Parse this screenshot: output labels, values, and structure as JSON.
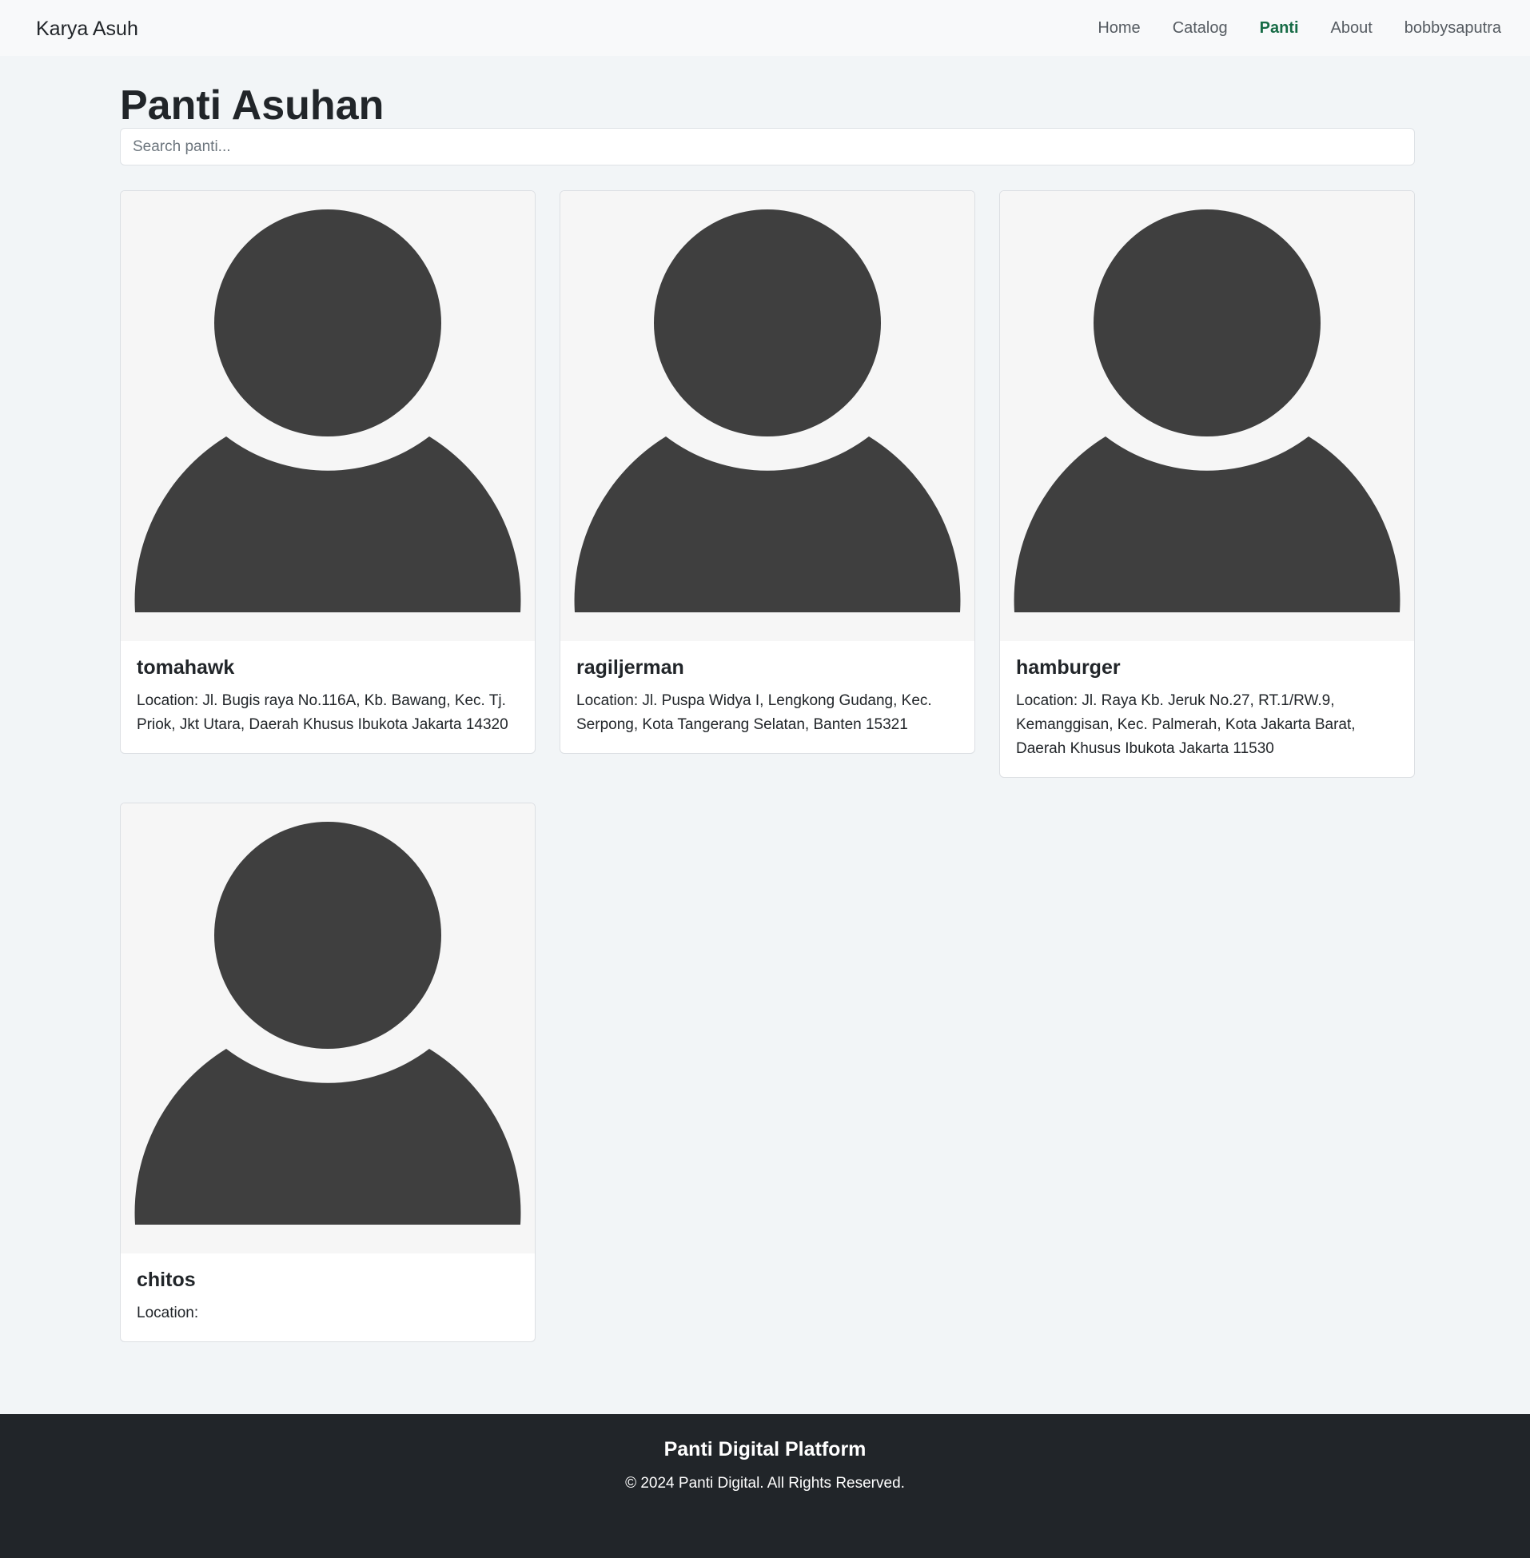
{
  "navbar": {
    "brand": "Karya Asuh",
    "links": [
      {
        "label": "Home",
        "active": false
      },
      {
        "label": "Catalog",
        "active": false
      },
      {
        "label": "Panti",
        "active": true
      },
      {
        "label": "About",
        "active": false
      },
      {
        "label": "bobbysaputra",
        "active": false
      }
    ]
  },
  "main": {
    "title": "Panti Asuhan",
    "search": {
      "placeholder": "Search panti...",
      "value": ""
    },
    "cards": [
      {
        "name": "tomahawk",
        "location": "Location: Jl. Bugis raya No.116A, Kb. Bawang, Kec. Tj. Priok, Jkt Utara, Daerah Khusus Ibukota Jakarta 14320",
        "image_icon": "person-placeholder-icon"
      },
      {
        "name": "ragiljerman",
        "location": "Location: Jl. Puspa Widya I, Lengkong Gudang, Kec. Serpong, Kota Tangerang Selatan, Banten 15321",
        "image_icon": "person-placeholder-icon"
      },
      {
        "name": "hamburger",
        "location": "Location: Jl. Raya Kb. Jeruk No.27, RT.1/RW.9, Kemanggisan, Kec. Palmerah, Kota Jakarta Barat, Daerah Khusus Ibukota Jakarta 11530",
        "image_icon": "person-placeholder-icon"
      },
      {
        "name": "chitos",
        "location": "Location:",
        "image_icon": "person-placeholder-icon"
      }
    ]
  },
  "footer": {
    "title": "Panti Digital Platform",
    "copyright": "© 2024 Panti Digital. All Rights Reserved."
  },
  "colors": {
    "page_background": "#f2f5f7",
    "navbar_background": "#f8f9fa",
    "active_nav": "#166b45",
    "footer_background": "#212529",
    "placeholder_silhouette": "#3f3f3f",
    "placeholder_background": "#f6f6f6"
  }
}
